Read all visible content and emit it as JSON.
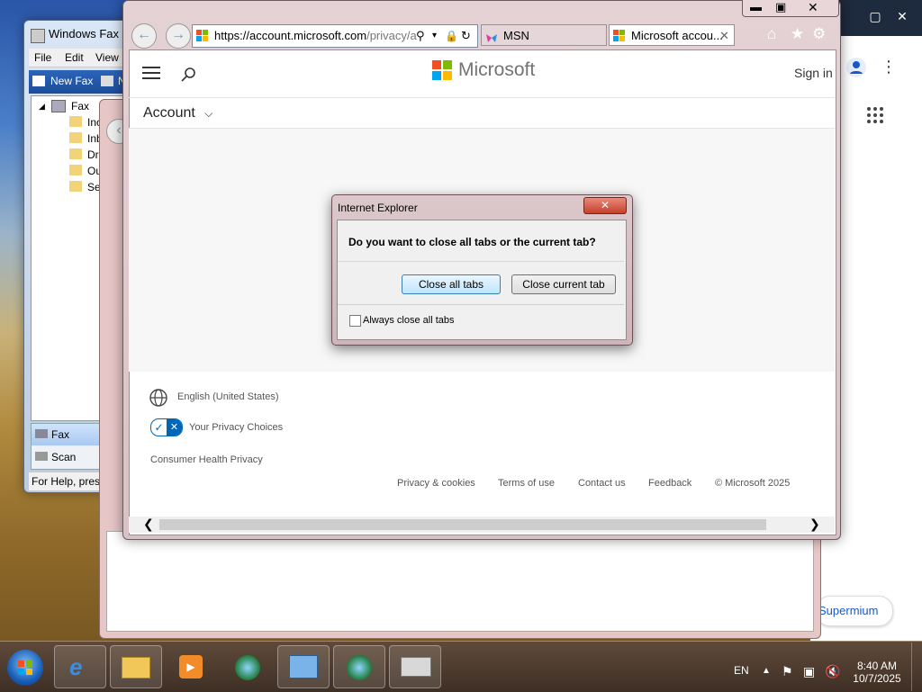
{
  "fax_window": {
    "title": "Windows Fax an",
    "menu": [
      "File",
      "Edit",
      "View"
    ],
    "toolbar": {
      "new_fax": "New Fax",
      "second": "N"
    },
    "tree": {
      "root": "Fax",
      "children": [
        "Inc",
        "Inb",
        "Dr",
        "Ou",
        "Se"
      ]
    },
    "nav": {
      "fax": "Fax",
      "scan": "Scan"
    },
    "status": "For Help, press"
  },
  "ie": {
    "address": {
      "prefix": "https://",
      "host": "account.microsoft.com",
      "path": "/privacy/a"
    },
    "tabs": [
      {
        "label": "MSN",
        "active": false
      },
      {
        "label": "Microsoft accou...",
        "active": true
      }
    ],
    "page": {
      "brand": "Microsoft",
      "sign_in": "Sign in",
      "account": "Account",
      "language": "English (United States)",
      "privacy_choices": "Your Privacy Choices",
      "consumer_health": "Consumer Health Privacy",
      "footer_links": [
        "Privacy & cookies",
        "Terms of use",
        "Contact us",
        "Feedback",
        "© Microsoft 2025"
      ]
    }
  },
  "dialog": {
    "title": "Internet Explorer",
    "question": "Do you want to close all tabs or the current tab?",
    "close_all": "Close all tabs",
    "close_current": "Close current tab",
    "checkbox_label": "Always close all tabs",
    "checkbox_checked": false
  },
  "background_browser": {
    "pill_label": "Supermium"
  },
  "taskbar": {
    "language": "EN",
    "time": "8:40 AM",
    "date": "10/7/2025"
  },
  "colors": {
    "ms_red": "#f25022",
    "ms_green": "#7fba00",
    "ms_blue": "#00a4ef",
    "ms_yellow": "#ffb900"
  }
}
